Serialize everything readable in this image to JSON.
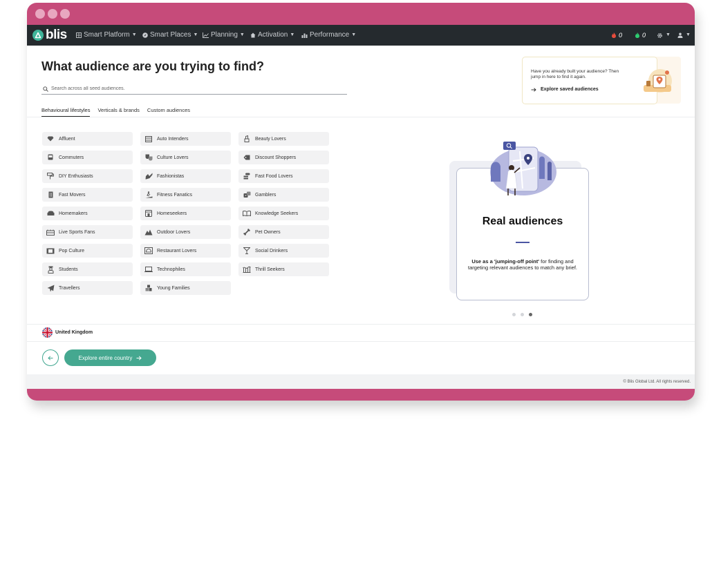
{
  "window": {
    "accent": "#c64b7a"
  },
  "navbar": {
    "logo_text": "blis",
    "items": [
      {
        "label": "Smart Platform",
        "icon": "grid-icon"
      },
      {
        "label": "Smart Places",
        "icon": "compass-icon"
      },
      {
        "label": "Planning",
        "icon": "line-chart-icon"
      },
      {
        "label": "Activation",
        "icon": "home-icon"
      },
      {
        "label": "Performance",
        "icon": "bar-chart-icon"
      }
    ],
    "counters": [
      {
        "value": "0",
        "icon": "flame-red-icon",
        "color": "#e74c3c"
      },
      {
        "value": "0",
        "icon": "flame-green-icon",
        "color": "#2ecc71"
      }
    ]
  },
  "main": {
    "heading": "What audience are you trying to find?",
    "search_placeholder": "Search across all seed audiences.",
    "tabs": [
      {
        "label": "Behavioural lifestyles",
        "active": true
      },
      {
        "label": "Verticals & brands",
        "active": false
      },
      {
        "label": "Custom audiences",
        "active": false
      }
    ],
    "audiences": [
      {
        "label": "Affluent",
        "icon": "diamond-icon"
      },
      {
        "label": "Auto Intenders",
        "icon": "car-icon"
      },
      {
        "label": "Beauty Lovers",
        "icon": "lipstick-icon"
      },
      {
        "label": "Commuters",
        "icon": "bus-icon"
      },
      {
        "label": "Culture Lovers",
        "icon": "masks-icon"
      },
      {
        "label": "Discount Shoppers",
        "icon": "tag-icon"
      },
      {
        "label": "DIY Enthusiasts",
        "icon": "paint-roller-icon"
      },
      {
        "label": "Fashionistas",
        "icon": "high-heel-icon"
      },
      {
        "label": "Fast Food Lovers",
        "icon": "burger-icon"
      },
      {
        "label": "Fast Movers",
        "icon": "trash-can-icon"
      },
      {
        "label": "Fitness Fanatics",
        "icon": "treadmill-icon"
      },
      {
        "label": "Gamblers",
        "icon": "dice-icon"
      },
      {
        "label": "Homemakers",
        "icon": "sofa-icon"
      },
      {
        "label": "Homeseekers",
        "icon": "house-icon"
      },
      {
        "label": "Knowledge Seekers",
        "icon": "book-icon"
      },
      {
        "label": "Live Sports Fans",
        "icon": "stadium-icon"
      },
      {
        "label": "Outdoor Lovers",
        "icon": "mountain-icon"
      },
      {
        "label": "Pet Owners",
        "icon": "bone-icon"
      },
      {
        "label": "Pop Culture",
        "icon": "film-icon"
      },
      {
        "label": "Restaurant Lovers",
        "icon": "cloche-icon"
      },
      {
        "label": "Social Drinkers",
        "icon": "cocktail-icon"
      },
      {
        "label": "Students",
        "icon": "student-icon"
      },
      {
        "label": "Technophiles",
        "icon": "laptop-icon"
      },
      {
        "label": "Thrill Seekers",
        "icon": "rollercoaster-icon"
      },
      {
        "label": "Travellers",
        "icon": "plane-icon"
      },
      {
        "label": "Young Families",
        "icon": "blocks-icon"
      }
    ]
  },
  "saved": {
    "text": "Have you already built your audience? Then jump in here to find it again.",
    "link": "Explore saved audiences"
  },
  "carousel": {
    "title": "Real audiences",
    "text_bold": "Use as a 'jumping-off point'",
    "text_rest": " for finding and targeting relevant audiences to match any brief.",
    "active_index": 2,
    "count": 3
  },
  "footer": {
    "country": "United Kingdom",
    "explore_button": "Explore entire country",
    "copyright": "© Blis Global Ltd. All rights reserved."
  }
}
